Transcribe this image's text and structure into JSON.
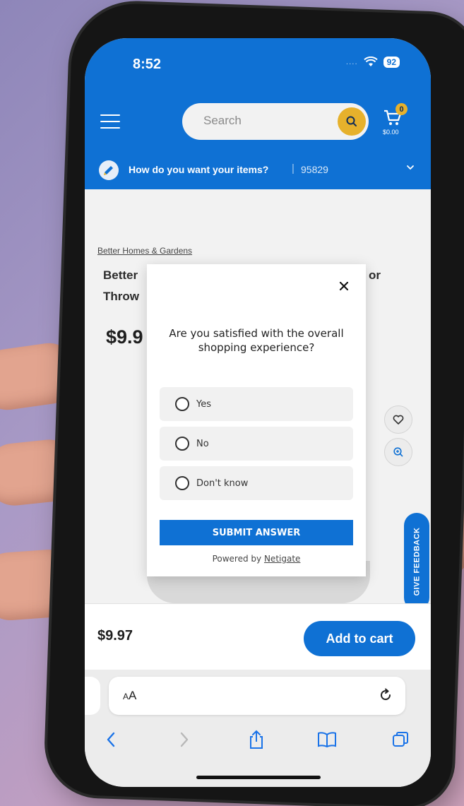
{
  "status_bar": {
    "time": "8:52",
    "signal": "....",
    "battery": "92"
  },
  "header": {
    "search_placeholder": "Search",
    "cart_count": "0",
    "cart_total": "$0.00"
  },
  "delivery": {
    "question": "How do you want your items?",
    "separator": "|",
    "zip": "95829"
  },
  "product": {
    "brand": "Better Homes & Gardens",
    "title_left_line1": "Better",
    "title_left_line2": "Throw",
    "title_right_fragment": "or",
    "price_fragment": "$9.9"
  },
  "survey": {
    "question": "Are you satisfied with the overall shopping experience?",
    "options": [
      {
        "label": "Yes"
      },
      {
        "label": "No"
      },
      {
        "label": "Don't know"
      }
    ],
    "submit_label": "SUBMIT ANSWER",
    "powered_prefix": "Powered by",
    "powered_brand": "Netigate"
  },
  "feedback_tab": {
    "label": "GIVE FEEDBACK"
  },
  "footer": {
    "price": "$9.97",
    "add_to_cart_label": "Add to cart"
  },
  "browser": {
    "aa_label_small": "A",
    "aa_label_large": "A"
  },
  "colors": {
    "brand_blue": "#0f71d4",
    "search_yellow": "#e6b12c"
  }
}
